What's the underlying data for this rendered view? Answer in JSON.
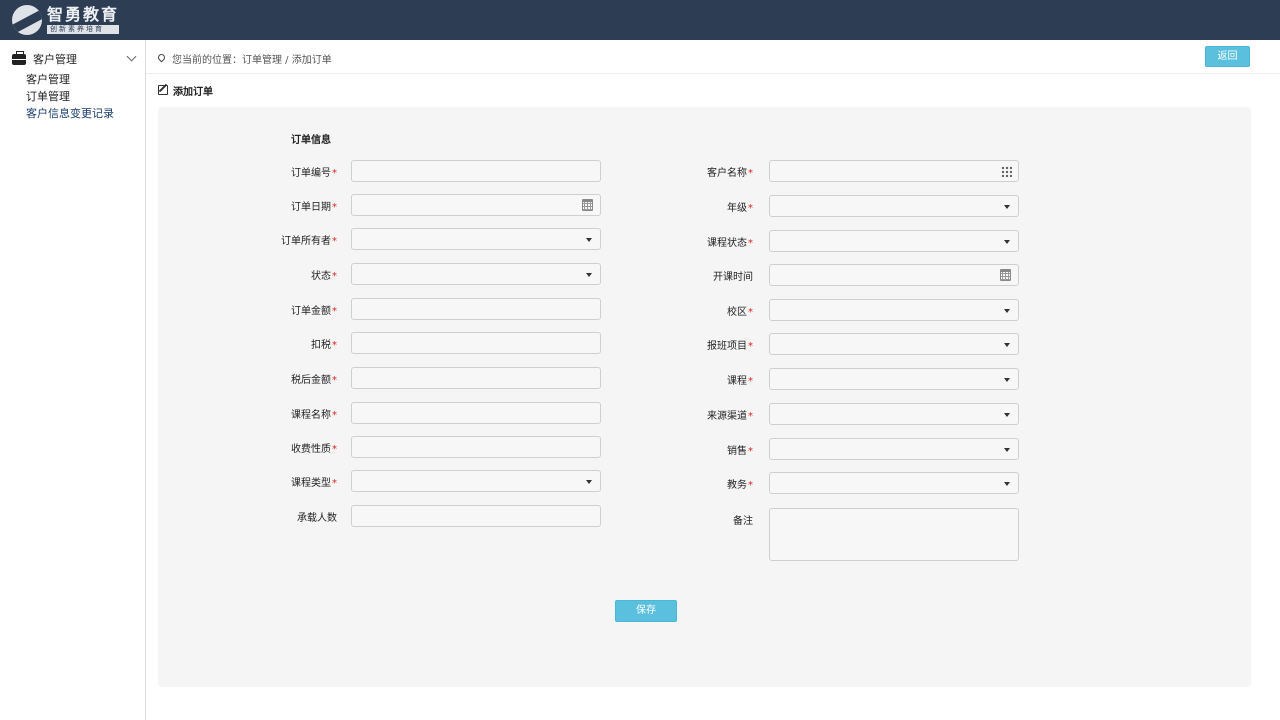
{
  "header": {
    "logo_name": "智勇教育",
    "logo_slogan": "创新素养培育"
  },
  "sidebar": {
    "group_label": "客户管理",
    "items": [
      {
        "label": "客户管理"
      },
      {
        "label": "订单管理"
      },
      {
        "label": "客户信息变更记录"
      }
    ]
  },
  "breadcrumb": {
    "text": "您当前的位置：订单管理 / 添加订单"
  },
  "back_label": "返回",
  "section_title": "添加订单",
  "form": {
    "group_title": "订单信息",
    "required_mark": "*",
    "left": [
      {
        "label": "订单编号",
        "required": true,
        "kind": "text",
        "value": ""
      },
      {
        "label": "订单日期",
        "required": true,
        "kind": "date",
        "value": ""
      },
      {
        "label": "订单所有者",
        "required": true,
        "kind": "select",
        "value": ""
      },
      {
        "label": "状态",
        "required": true,
        "kind": "select",
        "value": ""
      },
      {
        "label": "订单金额",
        "required": true,
        "kind": "text",
        "value": ""
      },
      {
        "label": "扣税",
        "required": true,
        "kind": "text",
        "value": ""
      },
      {
        "label": "税后金额",
        "required": true,
        "kind": "text",
        "value": ""
      },
      {
        "label": "课程名称",
        "required": true,
        "kind": "text",
        "value": ""
      },
      {
        "label": "收费性质",
        "required": true,
        "kind": "text",
        "value": ""
      },
      {
        "label": "课程类型",
        "required": true,
        "kind": "select",
        "value": ""
      },
      {
        "label": "承载人数",
        "required": false,
        "kind": "text",
        "value": ""
      }
    ],
    "right": [
      {
        "label": "客户名称",
        "required": true,
        "kind": "picker",
        "value": ""
      },
      {
        "label": "年级",
        "required": true,
        "kind": "select",
        "value": ""
      },
      {
        "label": "课程状态",
        "required": true,
        "kind": "select",
        "value": ""
      },
      {
        "label": "开课时间",
        "required": false,
        "kind": "date",
        "value": ""
      },
      {
        "label": "校区",
        "required": true,
        "kind": "select",
        "value": ""
      },
      {
        "label": "报班项目",
        "required": true,
        "kind": "select",
        "value": ""
      },
      {
        "label": "课程",
        "required": true,
        "kind": "select",
        "value": ""
      },
      {
        "label": "来源渠道",
        "required": true,
        "kind": "select",
        "value": ""
      },
      {
        "label": "销售",
        "required": true,
        "kind": "select",
        "value": ""
      },
      {
        "label": "教务",
        "required": true,
        "kind": "select",
        "value": ""
      },
      {
        "label": "备注",
        "required": false,
        "kind": "textarea",
        "value": ""
      }
    ]
  },
  "save_label": "保存",
  "colors": {
    "topbar": "#2d3e54",
    "button": "#5bc0de",
    "required": "#e02020",
    "panel": "#f5f5f5"
  }
}
